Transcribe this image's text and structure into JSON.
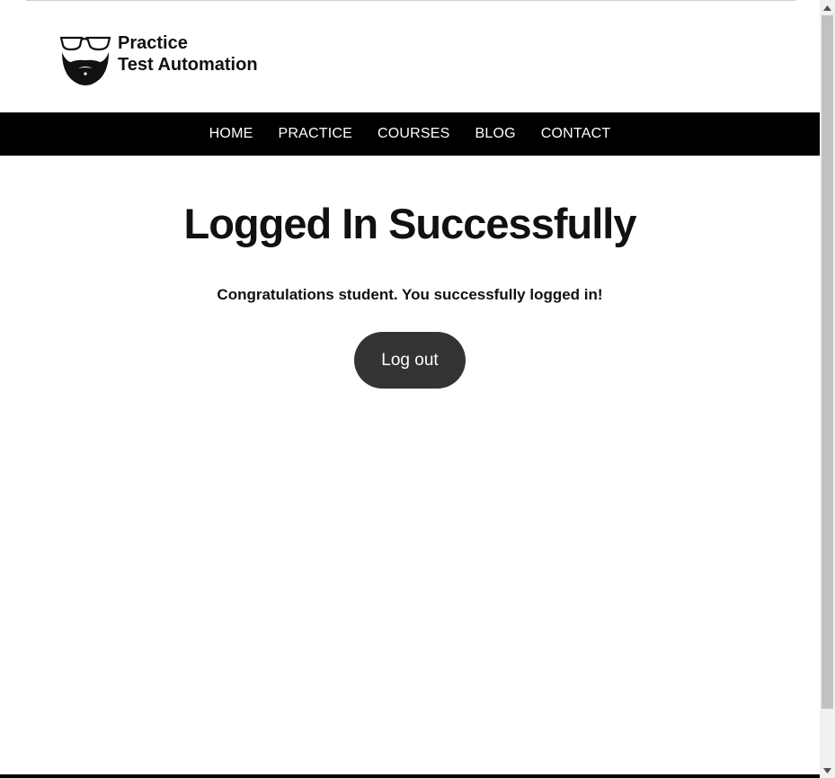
{
  "site": {
    "logo_line1": "Practice",
    "logo_line2": "Test Automation"
  },
  "nav": {
    "items": [
      "HOME",
      "PRACTICE",
      "COURSES",
      "BLOG",
      "CONTACT"
    ]
  },
  "main": {
    "title": "Logged In Successfully",
    "message": "Congratulations student. You successfully logged in!",
    "logout_label": "Log out"
  },
  "colors": {
    "navbar_bg": "#000000",
    "button_bg": "#333333",
    "text": "#111111"
  }
}
